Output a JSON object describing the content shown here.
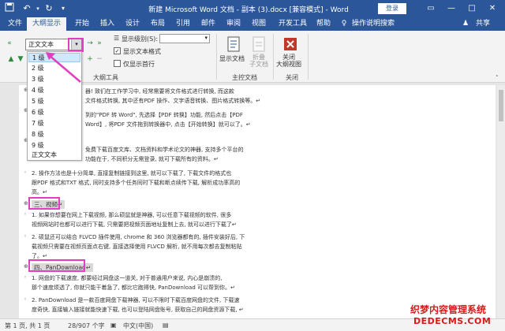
{
  "titlebar": {
    "title": "新建 Microsoft Word 文档 - 副本 (3).docx [兼容模式] - Word",
    "login": "登录"
  },
  "tabs": [
    "文件",
    "大纲显示",
    "开始",
    "插入",
    "设计",
    "布局",
    "引用",
    "邮件",
    "审阅",
    "视图",
    "开发工具",
    "帮助",
    "操作说明搜索"
  ],
  "share": "共享",
  "ribbon": {
    "level_value": "正文文本",
    "show_level_label": "显示级别(S):",
    "show_text_format": "显示文本格式",
    "show_first_line": "仅显示首行",
    "outline_tools_label": "大纲工具",
    "show_doc": "显示文档",
    "collapse_subdoc": "折叠\n子文档",
    "master_doc_label": "主控文档",
    "close_view": "关闭\n大纲视图",
    "close_label": "关闭"
  },
  "dropdown": {
    "options": [
      "1 级",
      "2 级",
      "3 级",
      "4 级",
      "5 级",
      "6 级",
      "7 级",
      "8 级",
      "9 级",
      "正文文本"
    ],
    "selected": "1 级"
  },
  "document": {
    "lines": [
      "器! 致们在工作学习中, 经常需要将文件格式进行转换, 而这款",
      "文件格式转换, 其中还有PDF 操作、文字语音转换、图片格式转换等。↵",
      "到的\"PDF 转 Word\", 先选择【PDF 转换】功能, 然后点击【PDF",
      "Word】, 将PDF 文件拖到转换器中, 点击【开始转换】就可以了。↵",
      "免费下载百度文库、文档资料和学术论文的神器, 支持多个平台的",
      "功能在于, 不同积分无需登录, 就可下载所有的资料。↵",
      "2. 操作方法也是十分简单, 直接复制链接到这里, 就可以下载了, 下载文件的格式也",
      "跟PDF 格式和TXT 格式, 同时支持多个任务同时下载和断点续传下载, 解析成功率高的",
      "高。↵",
      "三、视频↵",
      "1. 如果你想要在网上下载视频, 那么硕鼠就是神器, 可以任意下载视频的软件, 很多",
      "视频网站时也都可以进行下载, 只需要把视频页面地址复制上去, 就可以进行下载了↵",
      "2. 硕鼠还可以结合 FLVCD 插件使用, chrome 和 360 浏览器都有的, 插件安装好后, 下",
      "载视频只需要在视频页面点右键, 直接选择使用 FLVCD 解析, 就不用每次都去复制粘贴",
      "了。↵",
      "四、PanDownload↵",
      "1. 网盘的下载速度, 都要经过网盘这一道关, 对于普通用户来说, 内心是崩溃的,",
      "那个速度烦透了, 你就只能干着急了, 都比它跑得快, PanDownload 可以帮到你。↵",
      "2. PanDownload 是一款百度网盘下载神器, 可以不限时下载百度网盘的文件, 下载速",
      "度奇快, 直接输入链接就能快速下载, 也可以登陆网盘账号, 获取自己的网盘资源下载, ↵"
    ]
  },
  "statusbar": {
    "page": "第 1 页, 共 1 页",
    "words": "28/907 个字",
    "lang": "中文(中国)"
  },
  "watermark": {
    "line1": "织梦内容管理系统",
    "line2": "DEDECMS.COM"
  },
  "colors": {
    "word_blue": "#2b579a",
    "highlight_pink": "#e040c0",
    "selected_blue": "#cde8ff"
  }
}
